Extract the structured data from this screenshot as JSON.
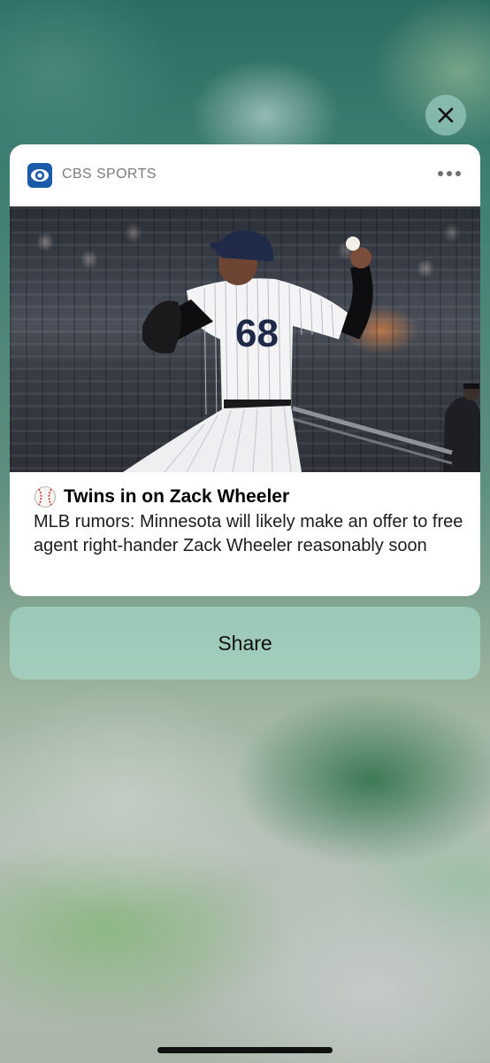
{
  "notification": {
    "app_name": "CBS SPORTS",
    "headline_emoji": "⚾",
    "headline": "Twins in on Zack Wheeler",
    "body": "MLB rumors: Minnesota will likely make an offer to free agent right-hander Zack Wheeler reasonably soon",
    "jersey_number": "68"
  },
  "actions": {
    "share_label": "Share"
  },
  "icons": {
    "close": "close-icon",
    "more": "more-options-icon",
    "app_logo": "cbs-eye-logo-icon"
  },
  "colors": {
    "cbs_blue": "#1a5aa8",
    "card_bg": "#ffffff",
    "share_bg": "rgba(170,225,210,.6)"
  }
}
